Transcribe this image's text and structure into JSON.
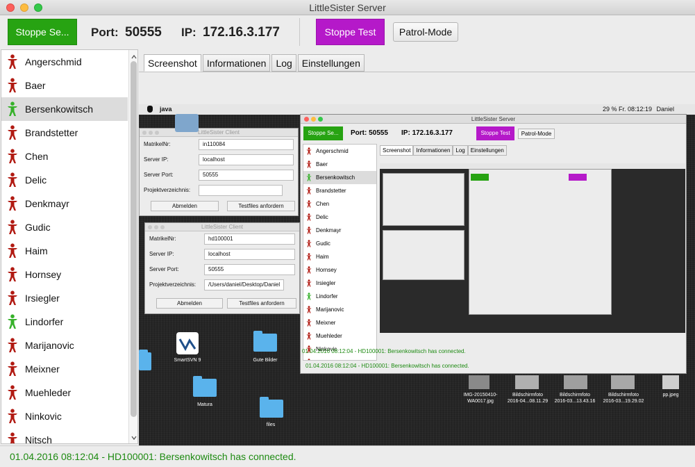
{
  "window": {
    "title": "LittleSister Server"
  },
  "toolbar": {
    "stop_server_label": "Stoppe Se...",
    "port_label": "Port:",
    "port_value": "50555",
    "ip_label": "IP:",
    "ip_value": "172.16.3.177",
    "stop_test_label": "Stoppe Test",
    "patrol_label": "Patrol-Mode"
  },
  "colors": {
    "online": "#36b12a",
    "offline": "#b11a12",
    "accent_green": "#27a312",
    "accent_purple": "#b519c9",
    "status_text": "#1d8a11"
  },
  "sidebar": {
    "items": [
      {
        "label": "Angerschmid",
        "status": "offline"
      },
      {
        "label": "Baer",
        "status": "offline"
      },
      {
        "label": "Bersenkowitsch",
        "status": "online",
        "selected": true
      },
      {
        "label": "Brandstetter",
        "status": "offline"
      },
      {
        "label": "Chen",
        "status": "offline"
      },
      {
        "label": "Delic",
        "status": "offline"
      },
      {
        "label": "Denkmayr",
        "status": "offline"
      },
      {
        "label": "Gudic",
        "status": "offline"
      },
      {
        "label": "Haim",
        "status": "offline"
      },
      {
        "label": "Hornsey",
        "status": "offline"
      },
      {
        "label": "Irsiegler",
        "status": "offline"
      },
      {
        "label": "Lindorfer",
        "status": "online"
      },
      {
        "label": "Marijanovic",
        "status": "offline"
      },
      {
        "label": "Meixner",
        "status": "offline"
      },
      {
        "label": "Muehleder",
        "status": "offline"
      },
      {
        "label": "Ninkovic",
        "status": "offline"
      },
      {
        "label": "Nitsch",
        "status": "offline"
      }
    ]
  },
  "tabs": [
    {
      "label": "Screenshot",
      "active": true
    },
    {
      "label": "Informationen"
    },
    {
      "label": "Log"
    },
    {
      "label": "Einstellungen"
    }
  ],
  "screenshot": {
    "menubar_app": "java",
    "menubar_status": "29 %  Fr. 08:12:19",
    "menubar_user": "Daniel",
    "client1": {
      "title": "LittleSister Client",
      "matrikel_label": "MatrikelNr:",
      "matrikel_value": "in110084",
      "ip_label": "Server IP:",
      "ip_value": "localhost",
      "port_label": "Server Port:",
      "port_value": "50555",
      "dir_label": "Projektverzeichnis:",
      "dir_value": "",
      "btn_logout": "Abmelden",
      "btn_testfiles": "Testfiles anfordern"
    },
    "client2": {
      "title": "LittleSister Client",
      "matrikel_label": "MatrikelNr:",
      "matrikel_value": "hd100001",
      "ip_label": "Server IP:",
      "ip_value": "localhost",
      "port_label": "Server Port:",
      "port_value": "50555",
      "dir_label": "Projektverzeichnis:",
      "dir_value": "/Users/daniel/Desktop/Daniel",
      "btn_logout": "Abmelden",
      "btn_testfiles": "Testfiles anfordern"
    },
    "desktop_icons": [
      {
        "label": "SmartSVN 9"
      },
      {
        "label": "Gute Bilder"
      },
      {
        "label": "Matura"
      },
      {
        "label": "files"
      },
      {
        "label": "IMG-20150410-\nWA0017.jpg"
      },
      {
        "label": "Bildschirmfoto\n2016-04...08.11.29"
      },
      {
        "label": "Bildschirmfoto\n2016-03...13.43.16"
      },
      {
        "label": "Bildschirmfoto\n2016-03...19.29.02"
      },
      {
        "label": "pp.jpeg"
      }
    ],
    "inner_status": "01.04.2016 08:12:04 - HD100001: Bersenkowitsch has connected."
  },
  "statusbar": {
    "message": "01.04.2016 08:12:04 - HD100001: Bersenkowitsch has connected."
  }
}
